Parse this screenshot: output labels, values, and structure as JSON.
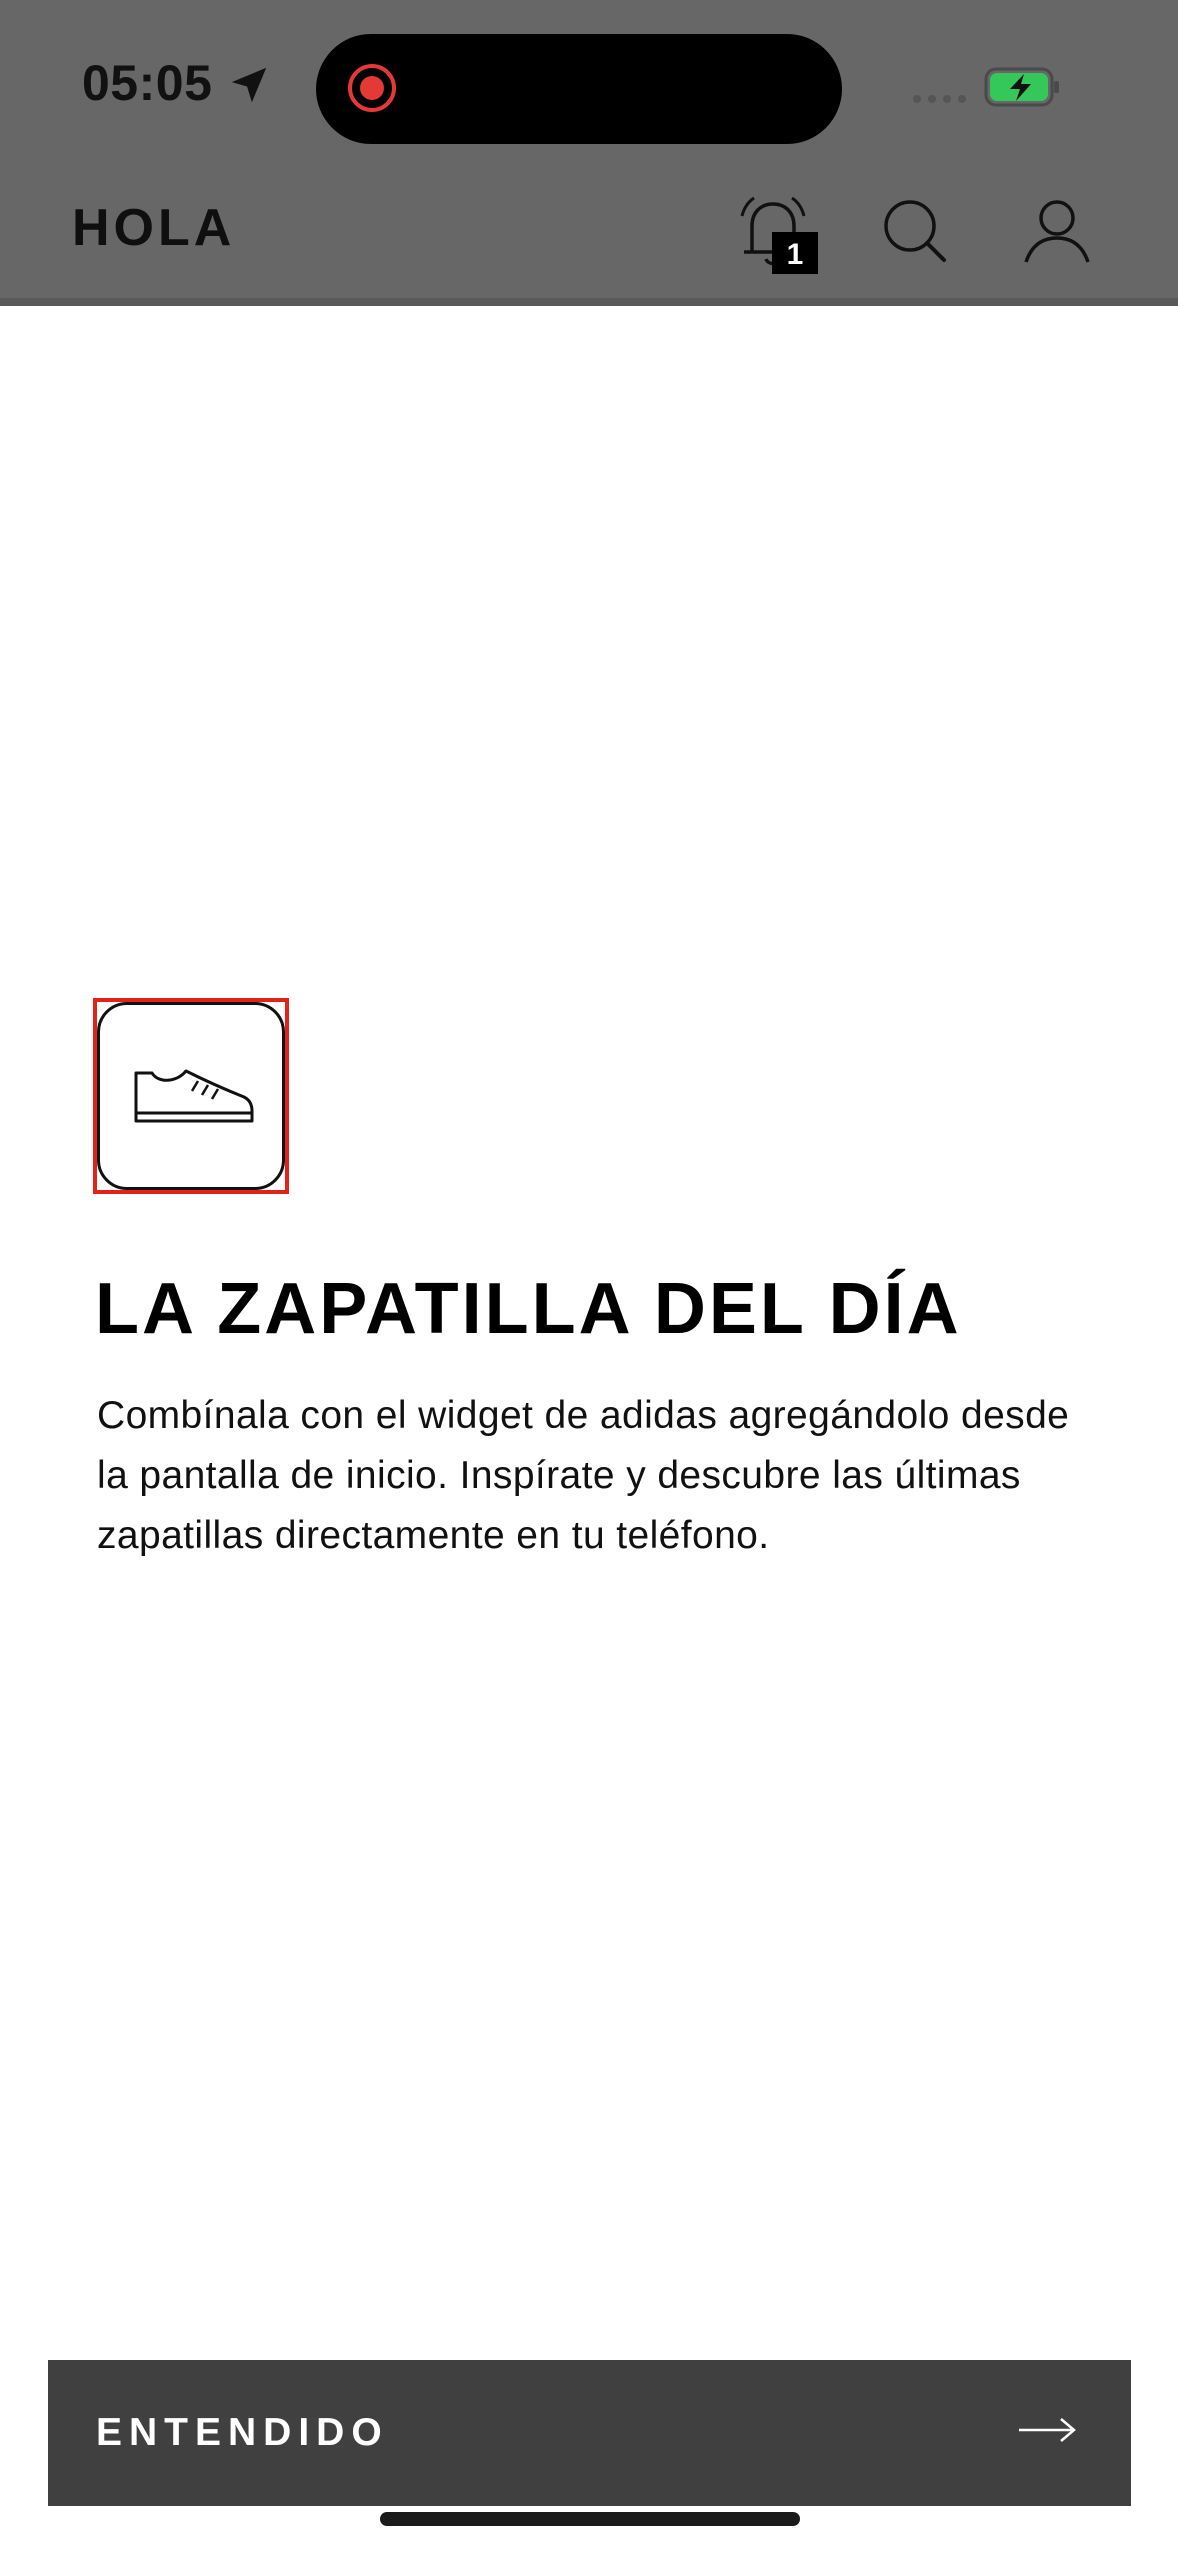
{
  "status_bar": {
    "time": "05:05"
  },
  "app_bar": {
    "title": "HOLA",
    "notification_count": "1",
    "icons": [
      "bell-icon",
      "search-icon",
      "user-icon"
    ]
  },
  "promo": {
    "icon": "sneaker-icon",
    "headline": "LA ZAPATILLA DEL DÍA",
    "description": "Combínala con el widget de adidas agregándolo desde la pantalla de inicio. Inspírate y descubre las últimas zapatillas directamente en tu teléfono."
  },
  "cta": {
    "label": "ENTENDIDO",
    "icon": "arrow-right-icon"
  },
  "colors": {
    "overlay": "#676767",
    "cta_background": "#404040",
    "highlight": "#e2231a",
    "battery_fill": "#34c759",
    "recording": "#e53935"
  }
}
